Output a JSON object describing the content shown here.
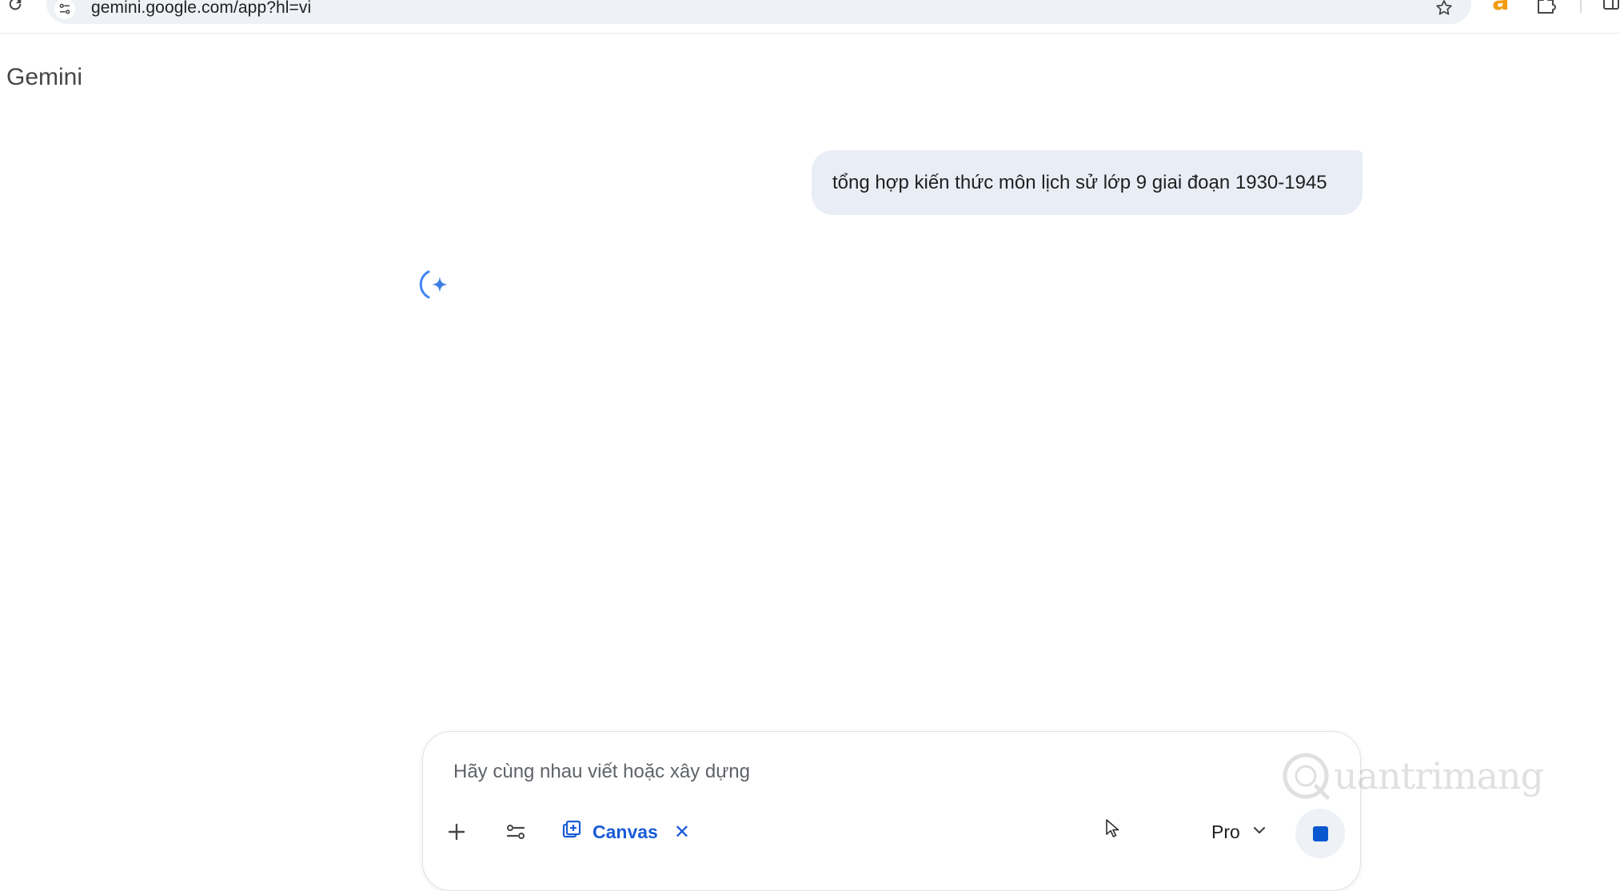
{
  "browser": {
    "url": "gemini.google.com/app?hl=vi",
    "icons": {
      "reload": "reload-icon",
      "site_info": "tune-icon",
      "bookmark": "star-icon",
      "extension": "amazon-a-icon",
      "extensions_menu": "puzzle-icon",
      "side_panel": "side-panel-icon"
    }
  },
  "app": {
    "title": "Gemini"
  },
  "conversation": {
    "user_message": "tổng hợp kiến thức môn lịch sử lớp 9 giai đoạn 1930-1945",
    "assistant_state_icon": "gemini-sparkle-loading-icon"
  },
  "composer": {
    "placeholder": "Hãy cùng nhau viết hoặc xây dựng",
    "value": "",
    "tools": {
      "add_icon": "plus-icon",
      "tools_icon": "tune-icon"
    },
    "canvas_chip": {
      "label": "Canvas",
      "icon": "canvas-icon",
      "close_icon": "close-icon"
    },
    "model": {
      "label": "Pro",
      "icon": "chevron-down-icon"
    },
    "stop_icon": "stop-icon"
  },
  "colors": {
    "accent": "#0b57d0",
    "bubble_bg": "#e9eef6",
    "omnibox_bg": "#eef1f6",
    "amazon_orange": "#f39c12"
  },
  "watermark": {
    "text": "uantrimang"
  }
}
